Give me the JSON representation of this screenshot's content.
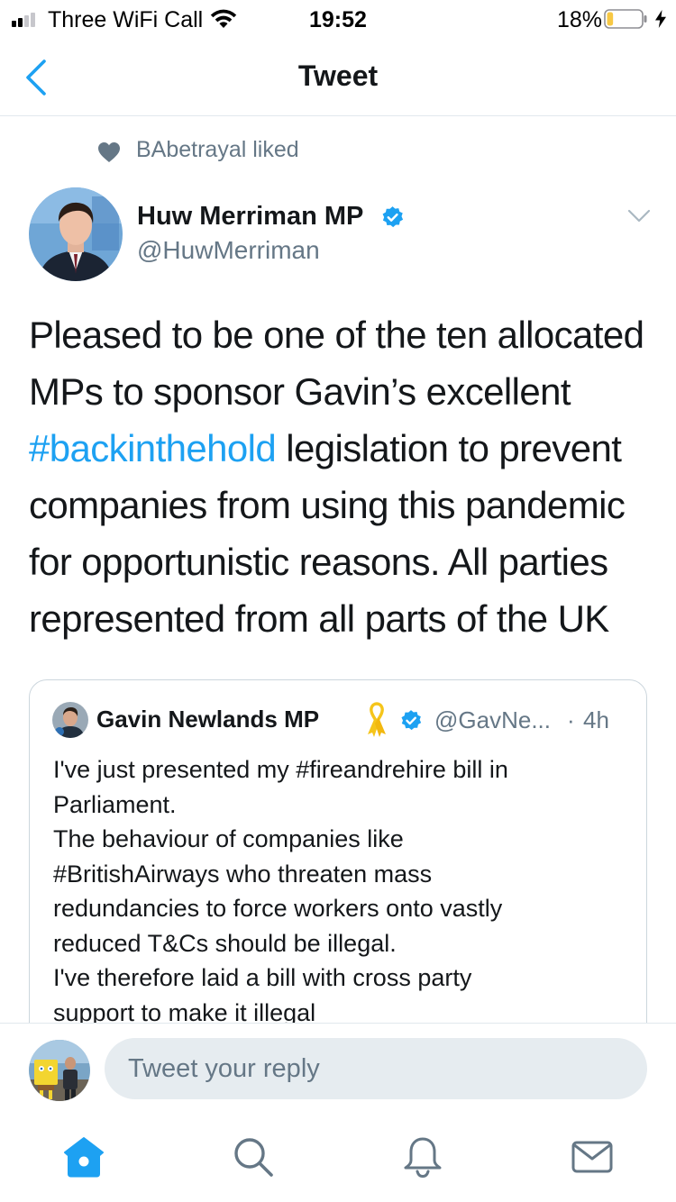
{
  "status_bar": {
    "carrier": "Three WiFi Call",
    "time": "19:52",
    "battery_percent": "18%",
    "battery_level": 0.18,
    "battery_color": "#f7c844",
    "icons": [
      "signal-icon",
      "wifi-icon",
      "battery-icon",
      "charging-bolt-icon"
    ]
  },
  "nav": {
    "title": "Tweet",
    "back_icon": "chevron-left-icon",
    "accent_color": "#1da1f2"
  },
  "social_context": {
    "icon": "heart-icon",
    "text": "BAbetrayal liked"
  },
  "tweet": {
    "author_name": "Huw Merriman MP",
    "author_handle": "@HuwMerriman",
    "verified": true,
    "text_lines": [
      {
        "parts": [
          {
            "text": "Pleased to be one of the ten allocated"
          }
        ]
      },
      {
        "parts": [
          {
            "text": "MPs to sponsor Gavin’s excellent"
          }
        ]
      },
      {
        "parts": [
          {
            "text": "#backinthehold",
            "hashtag": true
          },
          {
            "text": " legislation to prevent"
          }
        ]
      },
      {
        "parts": [
          {
            "text": "companies from using this pandemic"
          }
        ]
      },
      {
        "parts": [
          {
            "text": "for opportunistic reasons. All parties"
          }
        ]
      },
      {
        "parts": [
          {
            "text": "represented from all parts of the UK"
          }
        ]
      }
    ]
  },
  "quoted_tweet": {
    "author_name": "Gavin Newlands MP",
    "ribbon_icon": "yellow-ribbon-icon",
    "verified": true,
    "handle": "@GavNe...",
    "separator": "·",
    "time": "4h",
    "text_lines": [
      "I've just presented my #fireandrehire bill in",
      "Parliament.",
      "The behaviour of companies like",
      "#BritishAirways who threaten mass",
      "redundancies to force workers onto vastly",
      "reduced T&Cs should be illegal.",
      "I've therefore laid a bill with cross party",
      "support to make it illegal"
    ]
  },
  "reply": {
    "placeholder": "Tweet your reply"
  },
  "tabs": [
    {
      "name": "home",
      "icon": "home-icon",
      "active": true
    },
    {
      "name": "search",
      "icon": "search-icon",
      "active": false
    },
    {
      "name": "notifications",
      "icon": "bell-icon",
      "active": false
    },
    {
      "name": "messages",
      "icon": "mail-icon",
      "active": false
    }
  ]
}
